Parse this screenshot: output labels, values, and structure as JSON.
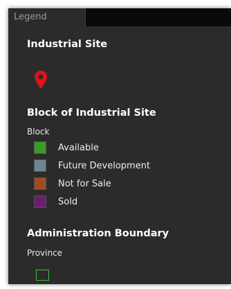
{
  "tabs": [
    {
      "label": "Legend"
    }
  ],
  "sections": {
    "industrial_site": {
      "title": "Industrial Site",
      "icon": "map-pin-icon",
      "icon_color": "#e0121b"
    },
    "block": {
      "title": "Block of Industrial Site",
      "field_label": "Block",
      "items": [
        {
          "label": "Available",
          "color": "#3a9a26"
        },
        {
          "label": "Future Development",
          "color": "#6b8794"
        },
        {
          "label": "Not for Sale",
          "color": "#a24a23"
        },
        {
          "label": "Sold",
          "color": "#6b1f6e"
        }
      ]
    },
    "administration": {
      "title": "Administration Boundary",
      "field_label": "Province",
      "outline_color": "#3bbf3b"
    }
  }
}
